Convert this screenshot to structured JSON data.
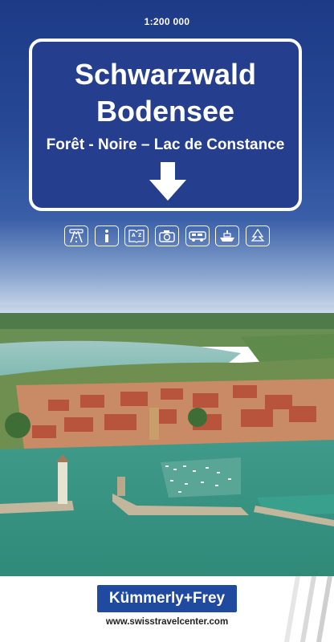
{
  "cover": {
    "scale": "1:200 000",
    "title_line1": "Schwarzwald",
    "title_line2": "Bodensee",
    "subtitle": "Forêt - Noire – Lac de Constance"
  },
  "icons": [
    {
      "name": "road-map-icon",
      "glyph": "🛣"
    },
    {
      "name": "info-icon",
      "glyph": "i"
    },
    {
      "name": "a-z-index-icon",
      "glyph": "A-Z"
    },
    {
      "name": "camera-icon",
      "glyph": "📷"
    },
    {
      "name": "camper-van-icon",
      "glyph": "🚐"
    },
    {
      "name": "ship-icon",
      "glyph": "⛴"
    },
    {
      "name": "tree-icon",
      "glyph": "🌲"
    }
  ],
  "publisher": {
    "brand": "Kümmerly+Frey",
    "url": "www.swisstravelcenter.com"
  },
  "colors": {
    "sign_blue": "#253f8e",
    "brand_blue": "#1f4aa0"
  }
}
